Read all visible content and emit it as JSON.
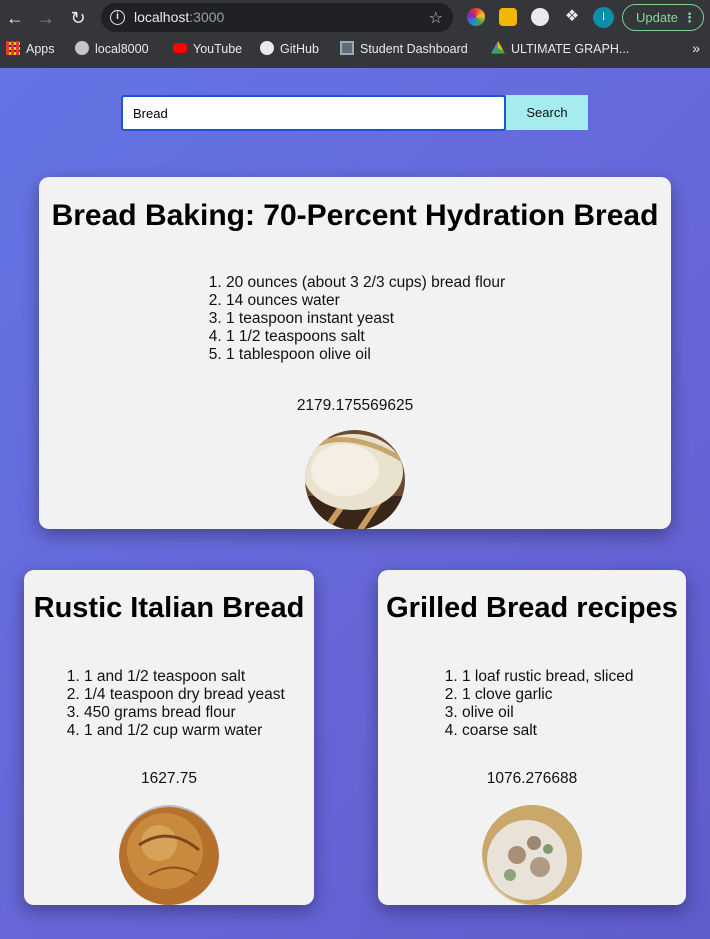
{
  "browser": {
    "url_host": "localhost",
    "url_port": ":3000",
    "update_label": "Update",
    "avatar_initial": "I",
    "bookmarks": [
      {
        "label": "Apps",
        "icon": "apps-grid-icon"
      },
      {
        "label": "local8000",
        "icon": "globe-icon"
      },
      {
        "label": "YouTube",
        "icon": "youtube-icon"
      },
      {
        "label": "GitHub",
        "icon": "github-icon"
      },
      {
        "label": "Student Dashboard",
        "icon": "dashboard-icon"
      },
      {
        "label": "ULTIMATE GRAPH...",
        "icon": "drive-icon"
      }
    ]
  },
  "search": {
    "value": "Bread",
    "button_label": "Search"
  },
  "recipes": [
    {
      "title": "Bread Baking: 70-Percent Hydration Bread",
      "ingredients": [
        "20 ounces (about 3 2/3 cups) bread flour",
        "14 ounces water",
        "1 teaspoon instant yeast",
        "1 1/2 teaspoons salt",
        "1 tablespoon olive oil"
      ],
      "score": "2179.175569625"
    },
    {
      "title": "Rustic Italian Bread",
      "ingredients": [
        "1 and 1/2 teaspoon salt",
        "1/4 teaspoon dry bread yeast",
        "450 grams bread flour",
        "1 and 1/2 cup warm water"
      ],
      "score": "1627.75"
    },
    {
      "title": "Grilled Bread recipes",
      "ingredients": [
        "1 loaf rustic bread, sliced",
        "1 clove garlic",
        "olive oil",
        "coarse salt"
      ],
      "score": "1076.276688"
    }
  ],
  "colors": {
    "background": "#6670e0",
    "card": "#f2f2f2",
    "search_button": "#a6ecef",
    "input_border": "#1a56d6"
  }
}
